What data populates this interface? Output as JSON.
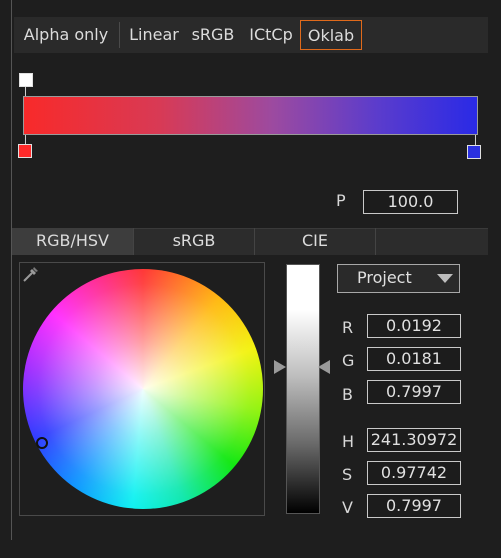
{
  "interpolation_tabs": [
    {
      "label": "Alpha only"
    },
    {
      "label": "Linear"
    },
    {
      "label": "sRGB"
    },
    {
      "label": "ICtCp"
    },
    {
      "label": "Oklab",
      "selected": true
    }
  ],
  "gradient": {
    "start_color": "#f82a2a",
    "end_color": "#2a2ae6",
    "start_stop_color": "#ff2a2a",
    "end_stop_color": "#2a30e0",
    "alpha_stop_color": "#ffffff"
  },
  "position": {
    "label": "P",
    "value": "100.0"
  },
  "model_tabs": [
    {
      "label": "RGB/HSV",
      "selected": true
    },
    {
      "label": "sRGB"
    },
    {
      "label": "CIE"
    }
  ],
  "space_select": {
    "value": "Project"
  },
  "rgb": [
    {
      "label": "R",
      "value": "0.0192"
    },
    {
      "label": "G",
      "value": "0.0181"
    },
    {
      "label": "B",
      "value": "0.7997"
    }
  ],
  "hsv": [
    {
      "label": "H",
      "value": "241.30972"
    },
    {
      "label": "S",
      "value": "0.97742"
    },
    {
      "label": "V",
      "value": "0.7997"
    }
  ],
  "icons": {
    "picker": "eyedropper-icon",
    "dropdown": "chevron-down-icon"
  },
  "accent_color": "#e06a1b"
}
